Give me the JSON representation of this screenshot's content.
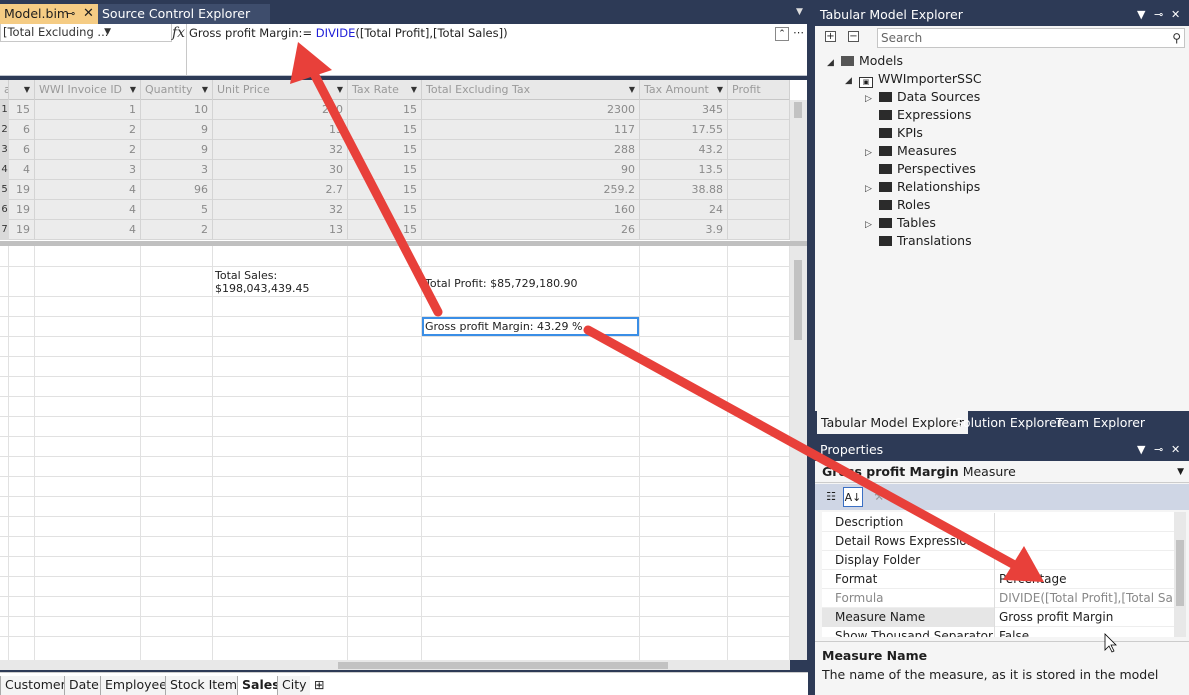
{
  "doc_tabs": {
    "model": "Model.bim",
    "pin": "⊸",
    "close": "✕",
    "source": "Source Control Explorer"
  },
  "formula_bar": {
    "measure_select": "[Total Excluding ...",
    "fx": "fx",
    "measure_name": "Gross profit Margin:",
    "formula_eq": "= ",
    "func": "DIVIDE",
    "args": "([Total Profit],[Total Sales])"
  },
  "grid": {
    "columns": [
      {
        "label": "a",
        "width": 9
      },
      {
        "label": "",
        "width": 26
      },
      {
        "label": "WWI Invoice ID",
        "width": 106
      },
      {
        "label": "Quantity",
        "width": 72
      },
      {
        "label": "Unit Price",
        "width": 135
      },
      {
        "label": "Tax Rate",
        "width": 74
      },
      {
        "label": "Total Excluding Tax",
        "width": 218
      },
      {
        "label": "Tax Amount",
        "width": 88
      },
      {
        "label": "Profit",
        "width": 62
      }
    ],
    "rows": [
      [
        "1",
        "15",
        "1",
        "10",
        "230",
        "15",
        "2300",
        "345"
      ],
      [
        "2",
        "6",
        "2",
        "9",
        "13",
        "15",
        "117",
        "17.55"
      ],
      [
        "3",
        "6",
        "2",
        "9",
        "32",
        "15",
        "288",
        "43.2"
      ],
      [
        "4",
        "4",
        "3",
        "3",
        "30",
        "15",
        "90",
        "13.5"
      ],
      [
        "5",
        "19",
        "4",
        "96",
        "2.7",
        "15",
        "259.2",
        "38.88"
      ],
      [
        "6",
        "19",
        "4",
        "5",
        "32",
        "15",
        "160",
        "24"
      ],
      [
        "7",
        "19",
        "4",
        "2",
        "13",
        "15",
        "26",
        "3.9"
      ]
    ],
    "measures": {
      "total_sales_label": "Total Sales:",
      "total_sales_value": "$198,043,439.45",
      "total_profit": "Total Profit: $85,729,180.90",
      "gross_margin": "Gross profit Margin: 43.29 %"
    }
  },
  "sheet_tabs": [
    "Customer",
    "Date",
    "Employee",
    "Stock Item",
    "Sales",
    "City"
  ],
  "active_sheet": "Sales",
  "tme": {
    "title": "Tabular Model Explorer",
    "search_placeholder": "Search",
    "root": "Models",
    "model": "WWImporterSSC",
    "children": [
      "Data Sources",
      "Expressions",
      "KPIs",
      "Measures",
      "Perspectives",
      "Relationships",
      "Roles",
      "Tables",
      "Translations"
    ],
    "tabs": [
      "Tabular Model Explorer",
      "Solution Explorer",
      "Team Explorer"
    ]
  },
  "properties": {
    "title": "Properties",
    "selected_name": "Gross profit Margin",
    "selected_type": "Measure",
    "rows": [
      {
        "name": "Description",
        "value": ""
      },
      {
        "name": "Detail Rows Expression",
        "value": ""
      },
      {
        "name": "Display Folder",
        "value": ""
      },
      {
        "name": "Format",
        "value": "Percentage"
      },
      {
        "name": "Formula",
        "value": "DIVIDE([Total Profit],[Total Sales])"
      },
      {
        "name": "Measure Name",
        "value": "Gross profit Margin"
      },
      {
        "name": "Show Thousand Separator",
        "value": "False"
      }
    ],
    "desc_title": "Measure Name",
    "desc_text": "The name of the measure, as it is stored in the model"
  },
  "colors": {
    "accent": "#e8403a",
    "selection": "#3a8ee6",
    "chrome": "#2d3a56"
  }
}
